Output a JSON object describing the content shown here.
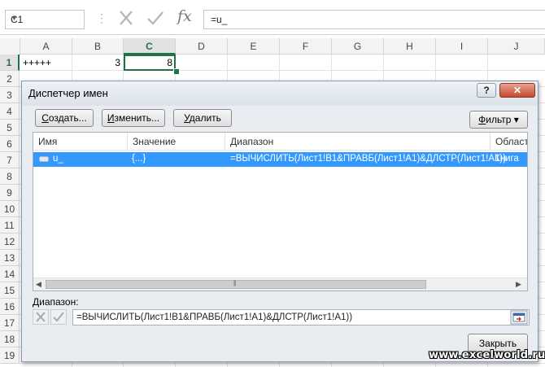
{
  "formula_bar": {
    "name_box": "C1",
    "fx": "fx",
    "formula": "=u_"
  },
  "grid": {
    "columns": [
      "A",
      "B",
      "C",
      "D",
      "E",
      "F",
      "G",
      "H",
      "I",
      "J"
    ],
    "selected_column": "C",
    "rows": [
      "1",
      "2",
      "3",
      "4",
      "5",
      "6",
      "7",
      "8",
      "9",
      "10",
      "11",
      "12",
      "13",
      "14",
      "15",
      "16",
      "17",
      "18",
      "19"
    ],
    "selected_row": "1",
    "cells": {
      "A1": "+++++",
      "B1": "3",
      "C1": "8"
    }
  },
  "dialog": {
    "title": "Диспетчер имен",
    "help": "?",
    "buttons": {
      "create": {
        "first": "С",
        "rest": "оздать..."
      },
      "edit": {
        "first": "И",
        "rest": "зменить..."
      },
      "delete": {
        "first": "У",
        "rest": "далить"
      },
      "filter": {
        "first": "Ф",
        "rest": "ильтр ▾"
      },
      "close": "Закрыть"
    },
    "columns": [
      "Имя",
      "Значение",
      "Диапазон",
      "Област"
    ],
    "rows": [
      {
        "name": "u_",
        "value": "{...}",
        "range": "=ВЫЧИСЛИТЬ(Лист1!B1&ПРАВБ(Лист1!A1)&ДЛСТР(Лист1!A1))",
        "scope": "Книга"
      }
    ],
    "range_label": {
      "first": "Д",
      "rest": "иапазон:"
    },
    "range_value": "=ВЫЧИСЛИТЬ(Лист1!B1&ПРАВБ(Лист1!A1)&ДЛСТР(Лист1!A1))"
  },
  "watermark": "www.excelworld.ru",
  "colors": {
    "accent": "#217346",
    "selection": "#3399ff",
    "close": "#c74a30"
  }
}
